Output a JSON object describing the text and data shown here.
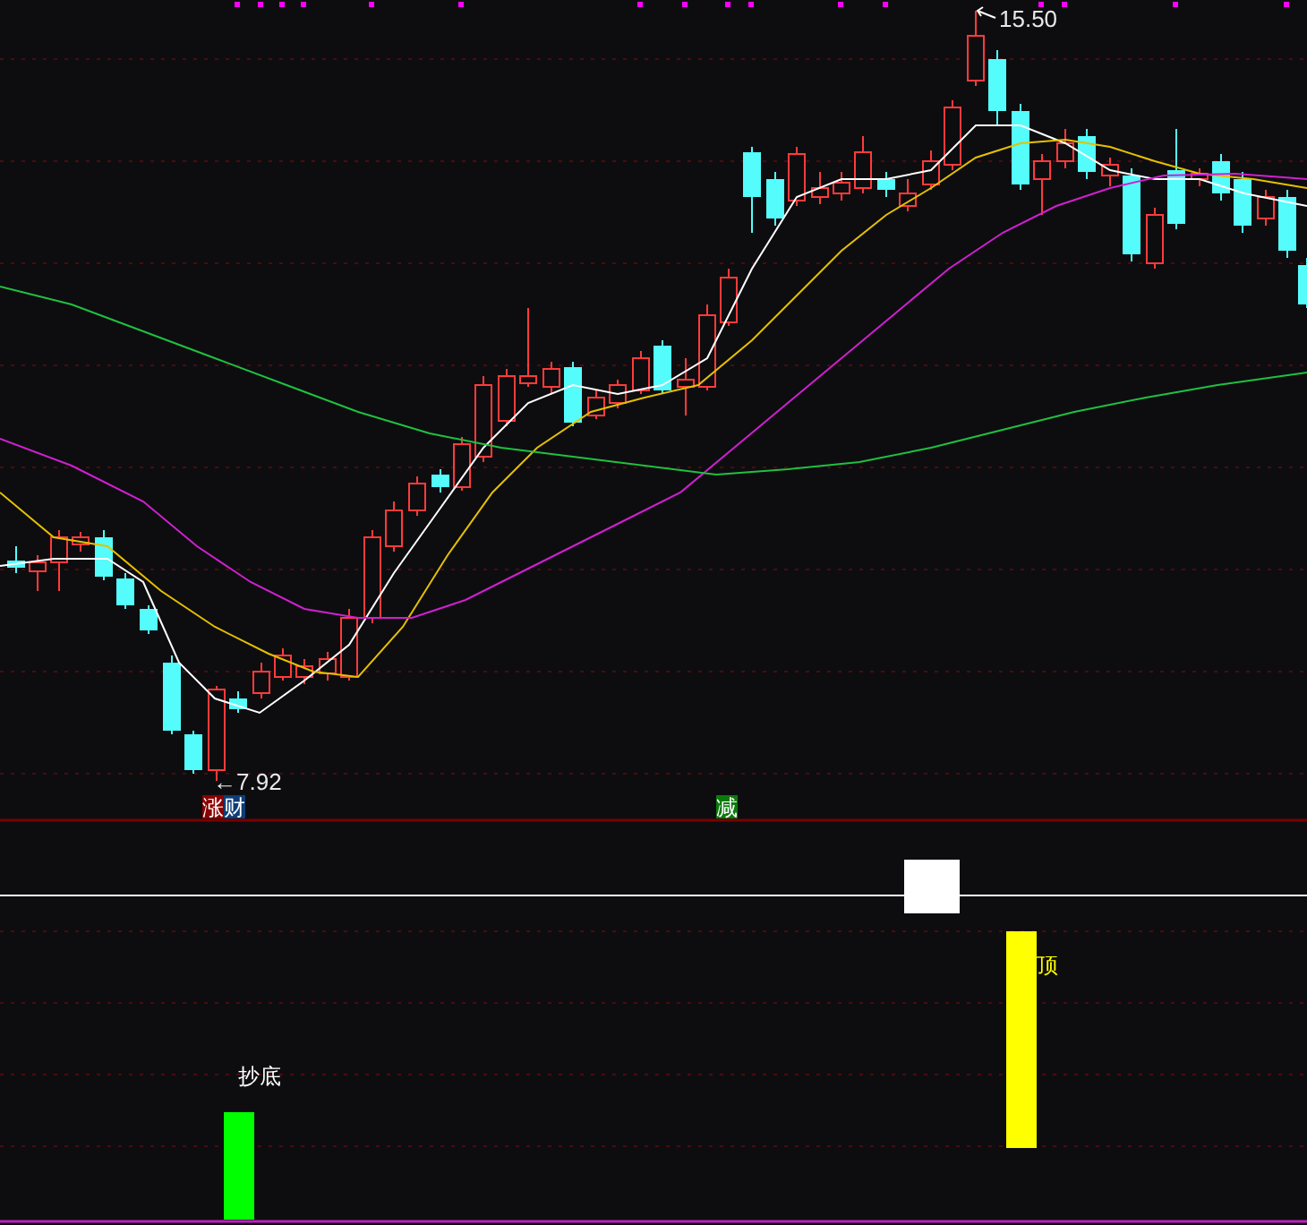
{
  "price_chart": {
    "high_label": "15.50",
    "low_label": "←7.92"
  },
  "signal_tags": [
    {
      "text": "涨",
      "color": "#8b0000"
    },
    {
      "text": "财",
      "color": "#0d3d78"
    },
    {
      "text": "减",
      "color": "#0b7a0b"
    }
  ],
  "indicator_pane": {
    "labels": [
      {
        "text": "抄底",
        "color": "#ffffff"
      },
      {
        "text": "顶",
        "color": "#ffff00"
      }
    ]
  }
}
